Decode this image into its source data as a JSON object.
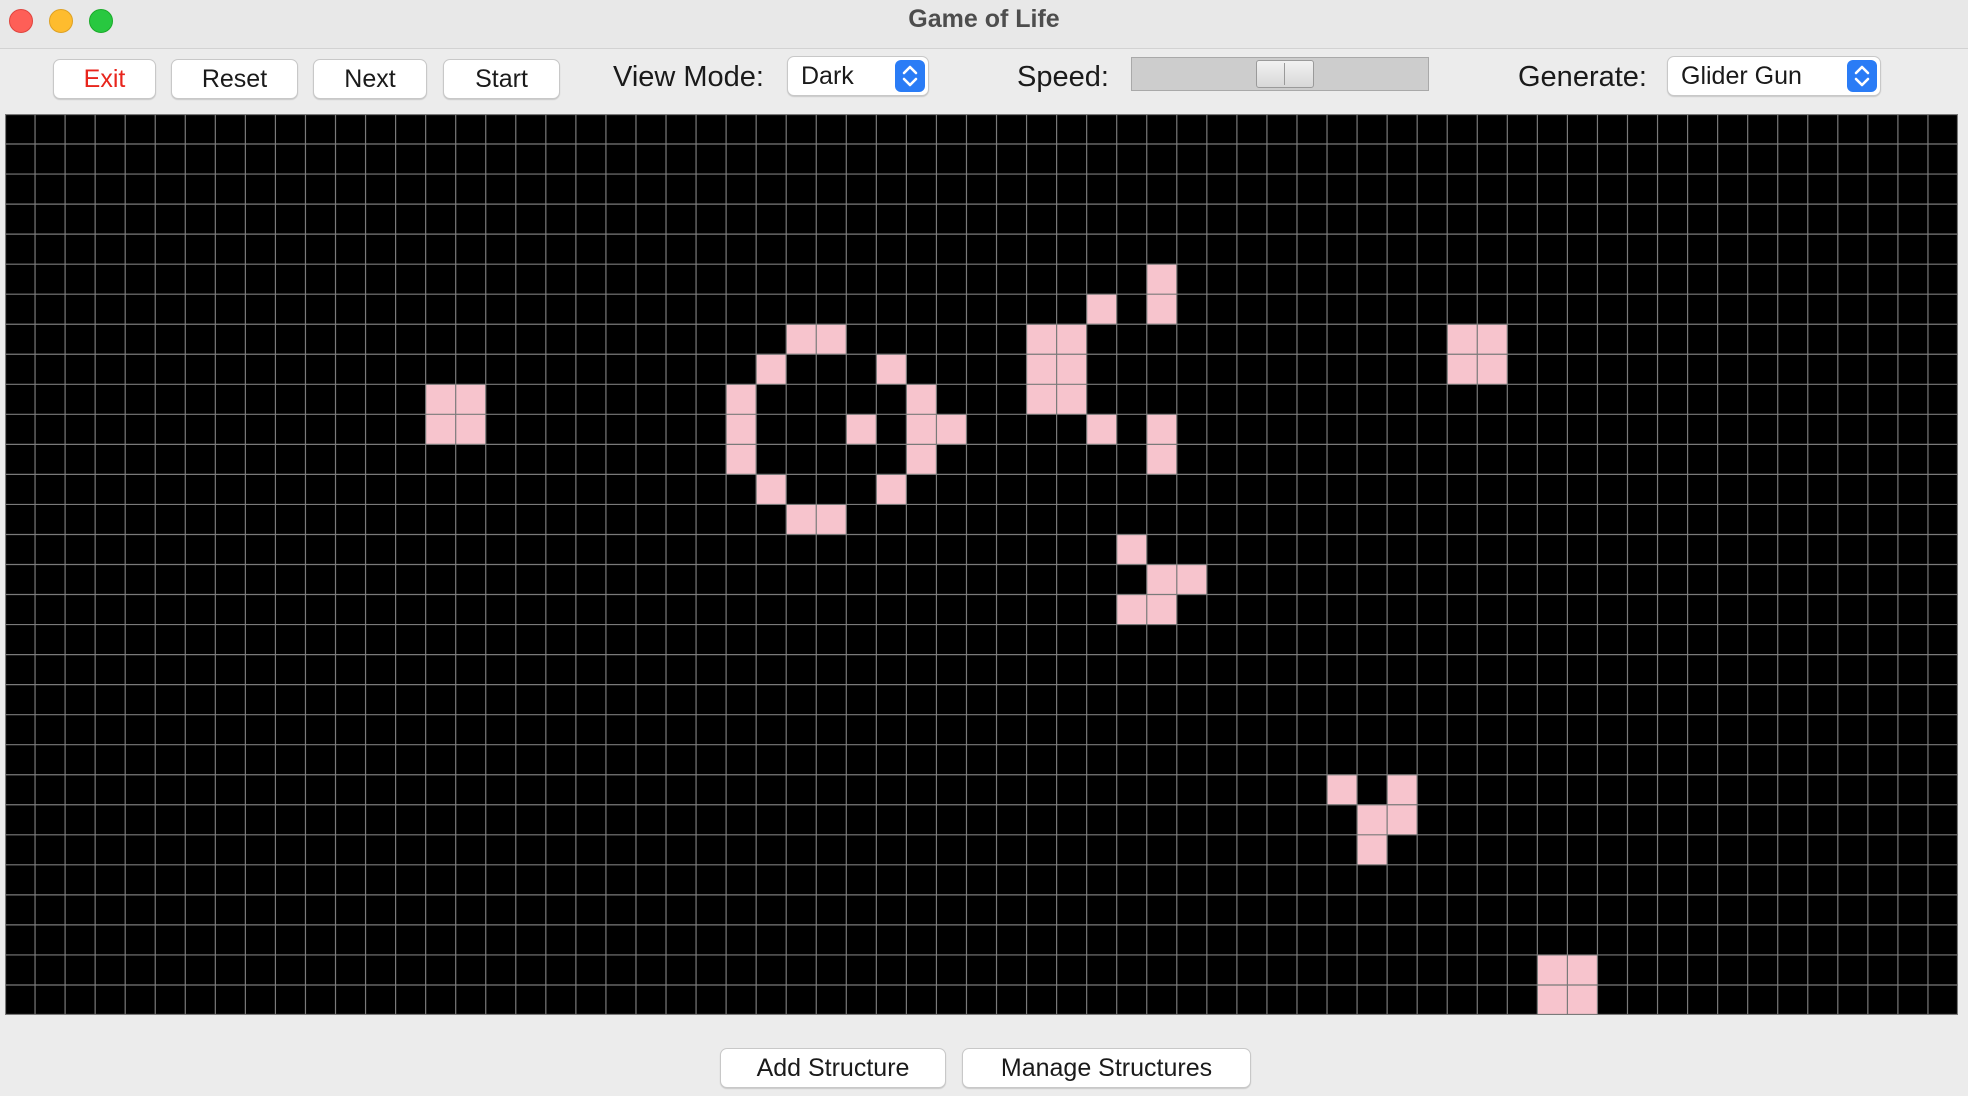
{
  "window": {
    "title": "Game of Life"
  },
  "toolbar": {
    "buttons": {
      "exit": "Exit",
      "reset": "Reset",
      "next": "Next",
      "start": "Start"
    },
    "view_mode": {
      "label": "View Mode:",
      "value": "Dark"
    },
    "speed": {
      "label": "Speed:",
      "value": 0.52
    },
    "generate": {
      "label": "Generate:",
      "value": "Glider Gun"
    }
  },
  "grid": {
    "columns": 65,
    "rows": 30,
    "background": "#000000",
    "line_color": "#7a7a7a",
    "alive_color": "#f7c4cd",
    "live_cells": [
      [
        14,
        9
      ],
      [
        15,
        9
      ],
      [
        14,
        10
      ],
      [
        15,
        10
      ],
      [
        26,
        7
      ],
      [
        27,
        7
      ],
      [
        25,
        8
      ],
      [
        29,
        8
      ],
      [
        24,
        9
      ],
      [
        30,
        9
      ],
      [
        24,
        10
      ],
      [
        28,
        10
      ],
      [
        30,
        10
      ],
      [
        31,
        10
      ],
      [
        24,
        11
      ],
      [
        30,
        11
      ],
      [
        25,
        12
      ],
      [
        29,
        12
      ],
      [
        26,
        13
      ],
      [
        27,
        13
      ],
      [
        38,
        5
      ],
      [
        36,
        6
      ],
      [
        38,
        6
      ],
      [
        34,
        7
      ],
      [
        35,
        7
      ],
      [
        34,
        8
      ],
      [
        35,
        8
      ],
      [
        34,
        9
      ],
      [
        35,
        9
      ],
      [
        36,
        10
      ],
      [
        38,
        10
      ],
      [
        38,
        11
      ],
      [
        48,
        7
      ],
      [
        49,
        7
      ],
      [
        48,
        8
      ],
      [
        49,
        8
      ],
      [
        37,
        14
      ],
      [
        38,
        15
      ],
      [
        39,
        15
      ],
      [
        37,
        16
      ],
      [
        38,
        16
      ],
      [
        44,
        22
      ],
      [
        46,
        22
      ],
      [
        45,
        23
      ],
      [
        46,
        23
      ],
      [
        45,
        24
      ],
      [
        51,
        28
      ],
      [
        52,
        28
      ],
      [
        51,
        29
      ],
      [
        52,
        29
      ]
    ]
  },
  "footer": {
    "add_structure": "Add Structure",
    "manage_structures": "Manage Structures"
  },
  "icons": {
    "close": "close-icon",
    "minimize": "minimize-icon",
    "maximize": "maximize-icon",
    "select_arrows": "chevron-updown-icon"
  }
}
